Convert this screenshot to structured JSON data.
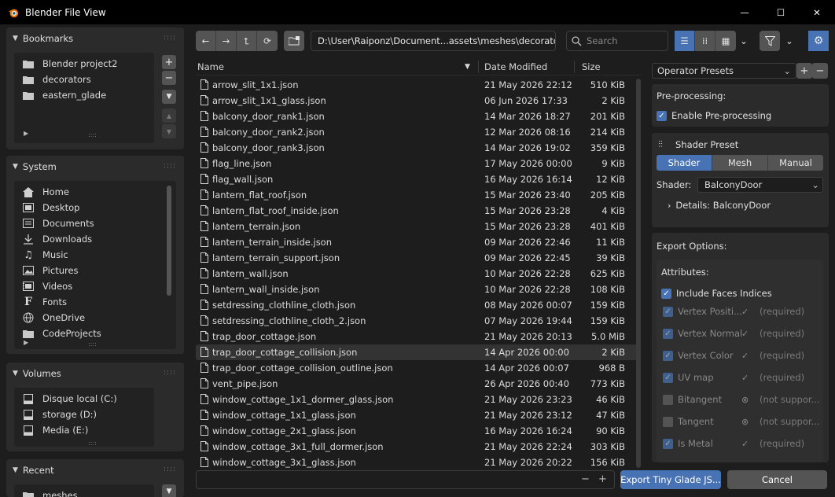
{
  "window": {
    "title": "Blender File View",
    "minimize": "—",
    "maximize": "☐",
    "close": "✕"
  },
  "sidebar": {
    "bookmarks": {
      "title": "Bookmarks",
      "items": [
        {
          "label": "Blender project2",
          "icon": "folder-icon"
        },
        {
          "label": "decorators",
          "icon": "folder-icon"
        },
        {
          "label": "eastern_glade",
          "icon": "folder-icon"
        }
      ]
    },
    "system": {
      "title": "System",
      "items": [
        {
          "label": "Home",
          "icon": "home-icon"
        },
        {
          "label": "Desktop",
          "icon": "desktop-icon"
        },
        {
          "label": "Documents",
          "icon": "documents-icon"
        },
        {
          "label": "Downloads",
          "icon": "downloads-icon"
        },
        {
          "label": "Music",
          "icon": "music-icon"
        },
        {
          "label": "Pictures",
          "icon": "pictures-icon"
        },
        {
          "label": "Videos",
          "icon": "videos-icon"
        },
        {
          "label": "Fonts",
          "icon": "fonts-icon"
        },
        {
          "label": "OneDrive",
          "icon": "globe-icon"
        },
        {
          "label": "CodeProjects",
          "icon": "folder-icon"
        }
      ]
    },
    "volumes": {
      "title": "Volumes",
      "items": [
        {
          "label": "Disque local (C:)",
          "icon": "drive-icon"
        },
        {
          "label": "storage (D:)",
          "icon": "drive-icon"
        },
        {
          "label": "Media (E:)",
          "icon": "drive-icon"
        }
      ]
    },
    "recent": {
      "title": "Recent",
      "items": [
        {
          "label": "meshes",
          "icon": "folder-icon"
        }
      ]
    }
  },
  "toolbar": {
    "path": "D:\\User\\Raiponz\\Document...assets\\meshes\\decorators\\",
    "search_placeholder": "Search"
  },
  "filelist": {
    "columns": {
      "name": "Name",
      "date": "Date Modified",
      "size": "Size"
    },
    "selected_index": 17,
    "rows": [
      {
        "name": "arrow_slit_1x1.json",
        "date": "21 May 2026 22:12",
        "size": "510 KiB"
      },
      {
        "name": "arrow_slit_1x1_glass.json",
        "date": "06 Jun 2026 17:33",
        "size": "2 KiB"
      },
      {
        "name": "balcony_door_rank1.json",
        "date": "14 Mar 2026 18:27",
        "size": "201 KiB"
      },
      {
        "name": "balcony_door_rank2.json",
        "date": "12 Mar 2026 08:16",
        "size": "214 KiB"
      },
      {
        "name": "balcony_door_rank3.json",
        "date": "14 Mar 2026 19:02",
        "size": "359 KiB"
      },
      {
        "name": "flag_line.json",
        "date": "17 May 2026 00:00",
        "size": "9 KiB"
      },
      {
        "name": "flag_wall.json",
        "date": "16 May 2026 16:14",
        "size": "12 KiB"
      },
      {
        "name": "lantern_flat_roof.json",
        "date": "15 Mar 2026 23:40",
        "size": "205 KiB"
      },
      {
        "name": "lantern_flat_roof_inside.json",
        "date": "15 Mar 2026 23:28",
        "size": "4 KiB"
      },
      {
        "name": "lantern_terrain.json",
        "date": "15 Mar 2026 23:28",
        "size": "401 KiB"
      },
      {
        "name": "lantern_terrain_inside.json",
        "date": "09 Mar 2026 22:46",
        "size": "11 KiB"
      },
      {
        "name": "lantern_terrain_support.json",
        "date": "09 Mar 2026 22:45",
        "size": "39 KiB"
      },
      {
        "name": "lantern_wall.json",
        "date": "10 Mar 2026 22:28",
        "size": "625 KiB"
      },
      {
        "name": "lantern_wall_inside.json",
        "date": "10 Mar 2026 22:28",
        "size": "108 KiB"
      },
      {
        "name": "setdressing_clothline_cloth.json",
        "date": "08 May 2026 00:07",
        "size": "159 KiB"
      },
      {
        "name": "setdressing_clothline_cloth_2.json",
        "date": "07 May 2026 19:44",
        "size": "159 KiB"
      },
      {
        "name": "trap_door_cottage.json",
        "date": "21 May 2026 20:13",
        "size": "5.0 MiB"
      },
      {
        "name": "trap_door_cottage_collision.json",
        "date": "14 Apr 2026 00:00",
        "size": "2 KiB"
      },
      {
        "name": "trap_door_cottage_collision_outline.json",
        "date": "14 Apr 2026 00:07",
        "size": "968 B"
      },
      {
        "name": "vent_pipe.json",
        "date": "26 Apr 2026 00:40",
        "size": "773 KiB"
      },
      {
        "name": "window_cottage_1x1_dormer_glass.json",
        "date": "21 May 2026 23:23",
        "size": "46 KiB"
      },
      {
        "name": "window_cottage_1x1_glass.json",
        "date": "21 May 2026 23:12",
        "size": "47 KiB"
      },
      {
        "name": "window_cottage_2x1_glass.json",
        "date": "16 May 2026 16:24",
        "size": "90 KiB"
      },
      {
        "name": "window_cottage_3x1_full_dormer.json",
        "date": "21 May 2026 22:24",
        "size": "303 KiB"
      },
      {
        "name": "window_cottage_3x1_glass.json",
        "date": "21 May 2026 20:22",
        "size": "156 KiB"
      }
    ]
  },
  "bottom": {
    "filename_value": "",
    "minus": "−",
    "plus": "+",
    "export_label": "Export Tiny Glade JS...",
    "cancel_label": "Cancel"
  },
  "right_panel": {
    "operator_presets": "Operator Presets",
    "preprocessing": {
      "title": "Pre-processing:",
      "enable_label": "Enable Pre-processing"
    },
    "shader_preset": {
      "title": "Shader Preset",
      "tabs": [
        "Shader",
        "Mesh",
        "Manual"
      ],
      "active_tab": "Shader",
      "shader_label": "Shader:",
      "shader_value": "BalconyDoor",
      "details_label": "Details: BalconyDoor"
    },
    "export_options": {
      "title": "Export Options:",
      "attributes_title": "Attributes:",
      "include_faces_label": "Include Faces Indices",
      "attributes": [
        {
          "name": "Vertex Positi...",
          "status": "(required)",
          "icon": "check-icon",
          "checked": true
        },
        {
          "name": "Vertex Normal",
          "status": "(required)",
          "icon": "check-icon",
          "checked": true
        },
        {
          "name": "Vertex Color",
          "status": "(required)",
          "icon": "check-icon",
          "checked": true
        },
        {
          "name": "UV map",
          "status": "(required)",
          "icon": "check-icon",
          "checked": true
        },
        {
          "name": "Bitangent",
          "status": "(not suppor...",
          "icon": "x-circle-icon",
          "checked": false
        },
        {
          "name": "Tangent",
          "status": "(not suppor...",
          "icon": "x-circle-icon",
          "checked": false
        },
        {
          "name": "Is Metal",
          "status": "(required)",
          "icon": "check-icon",
          "checked": true
        }
      ]
    }
  },
  "colors": {
    "accent": "#4772b3",
    "background": "#1d1d1d",
    "panel": "#2b2b2b",
    "button": "#545454"
  }
}
